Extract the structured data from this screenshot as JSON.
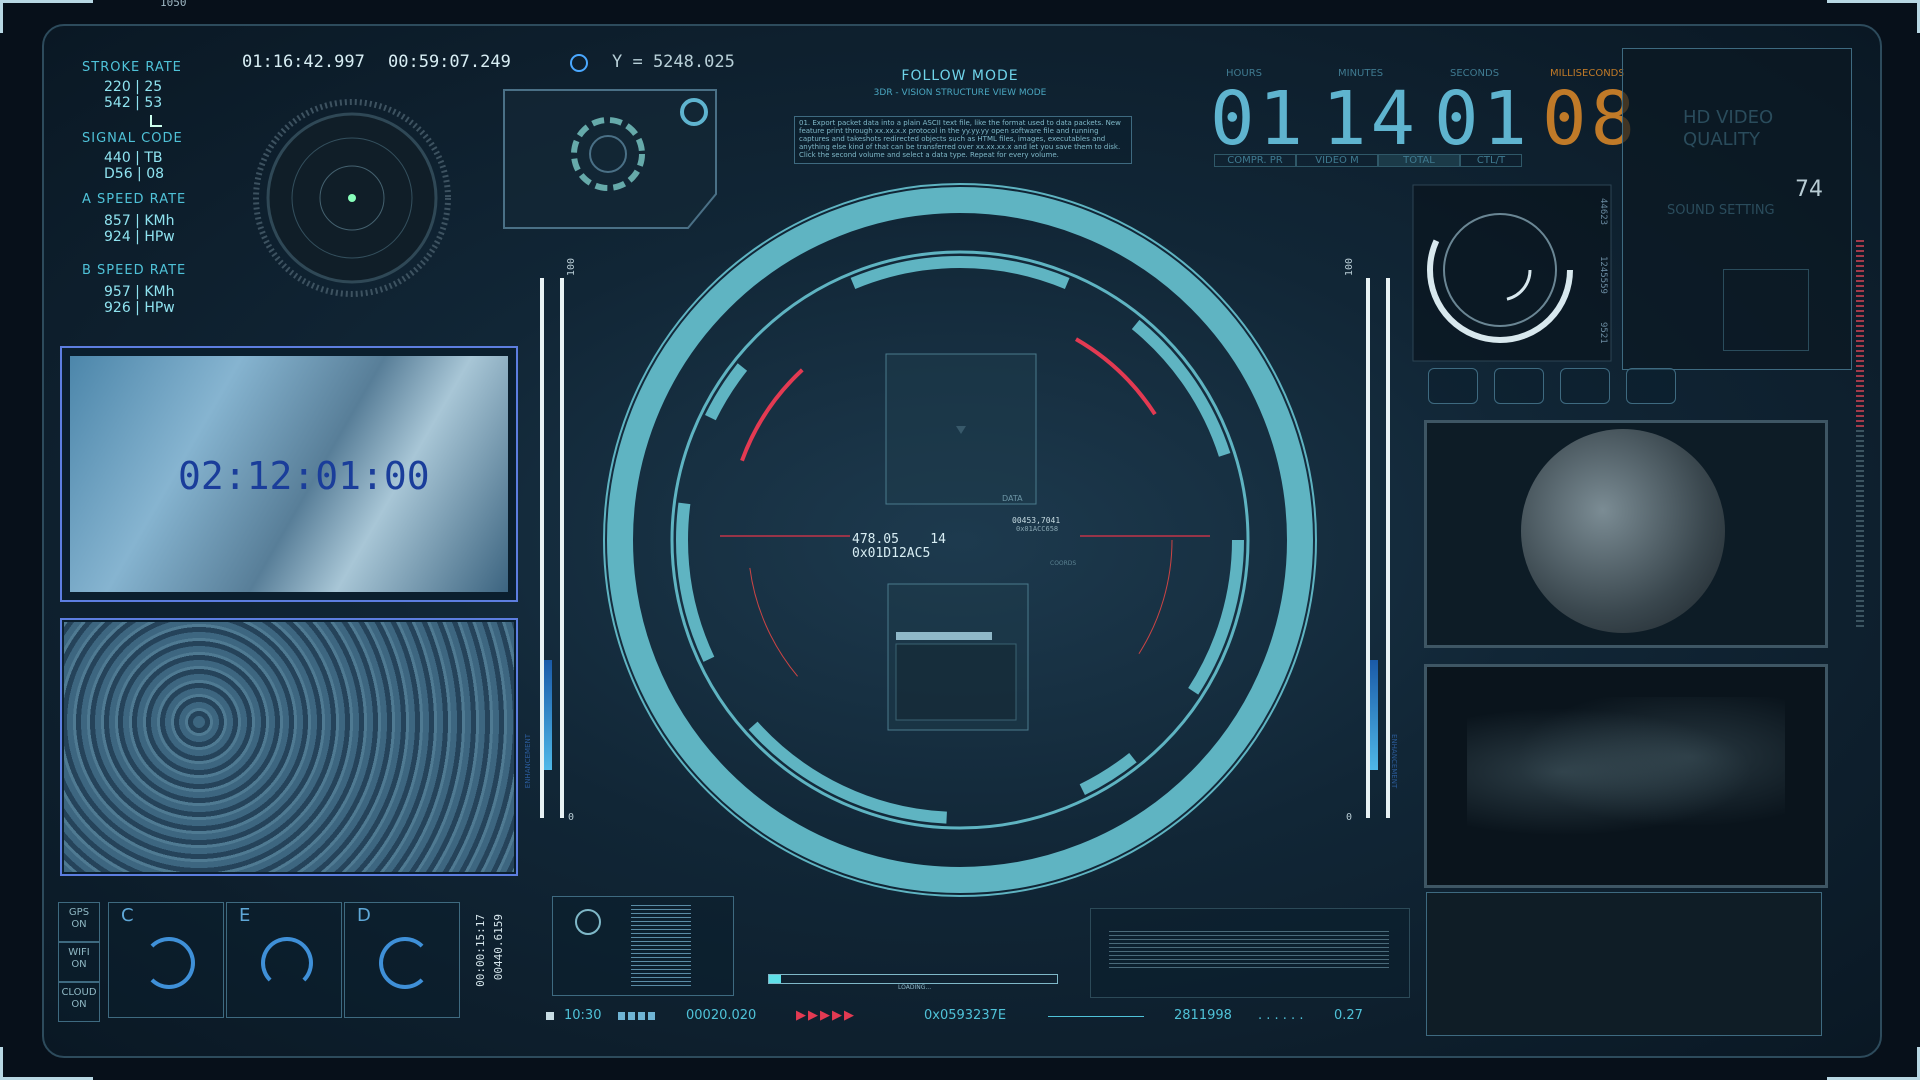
{
  "top_marker": "1050",
  "left_stats": {
    "stroke_rate": {
      "label": "STROKE RATE",
      "line1": "220 | 25",
      "line2": "542 | 53"
    },
    "signal_code": {
      "label": "SIGNAL CODE",
      "line1": "440 | TB",
      "line2": "D56 | 08"
    },
    "a_speed": {
      "label": "A SPEED RATE",
      "line1": "857 | KMh",
      "line2": "924 | HPw"
    },
    "b_speed": {
      "label": "B SPEED RATE",
      "line1": "957 | KMh",
      "line2": "926 | HPw"
    }
  },
  "header": {
    "time1": "01:16:42.997",
    "time2": "00:59:07.249",
    "y_readout": "Y = 5248.025",
    "follow_mode": "FOLLOW MODE",
    "subtitle": "3DR - VISION      STRUCTURE VIEW MODE",
    "small_text": "01. Export packet data into a plain ASCII text file, like the format used to data packets. New feature print through xx.xx.x.x protocol in the yy.yy.yy open software file and running captures and takeshots redirected objects such as HTML files, images, executables and anything else kind of that can be transferred over xx.xx.xx.x and let you save them to disk. Click the second volume and select a data type. Repeat for every volume."
  },
  "clock": {
    "labels": [
      "HOURS",
      "MINUTES",
      "SECONDS",
      "MILLISECONDS"
    ],
    "hours": "01",
    "minutes": "14",
    "seconds": "01",
    "ms": "08",
    "sub": [
      "COMPR. PR",
      "VIDEO M",
      "TOTAL",
      "CTL/T"
    ]
  },
  "right_panel": {
    "title1": "HD VIDEO",
    "title2": "QUALITY",
    "value": "74",
    "sound": "SOUND SETTING",
    "vnums": [
      "44623",
      "1245559",
      "9521"
    ]
  },
  "map_panel": {
    "timecode": "02:12:01:00"
  },
  "center": {
    "readout1": "478.05    14",
    "readout2": "0x01D12AC5",
    "small1": "00453,7041",
    "small2": "0x01ACC658",
    "data_label": "DATA",
    "coords_label": "COORDS",
    "scale_top": "100",
    "scale_bottom": "0",
    "loading": "LOADING..."
  },
  "side_scale": {
    "left_label": "ENHANCEMENT",
    "right_label": "ENHANCEMENT"
  },
  "bottom_left": {
    "toggles": [
      "GPS\nON",
      "WIFI\nON",
      "CLOUD\nON"
    ],
    "gauges": [
      "C",
      "E",
      "D"
    ],
    "vertical_code1": "00:00:15:17",
    "vertical_code2": "00440.6159"
  },
  "bottom_bar": {
    "t1": "10:30",
    "t2": "00020.020",
    "hex": "0x0593237E",
    "num": "2811998",
    "dots": ". . . . . .",
    "end": "0.27"
  }
}
